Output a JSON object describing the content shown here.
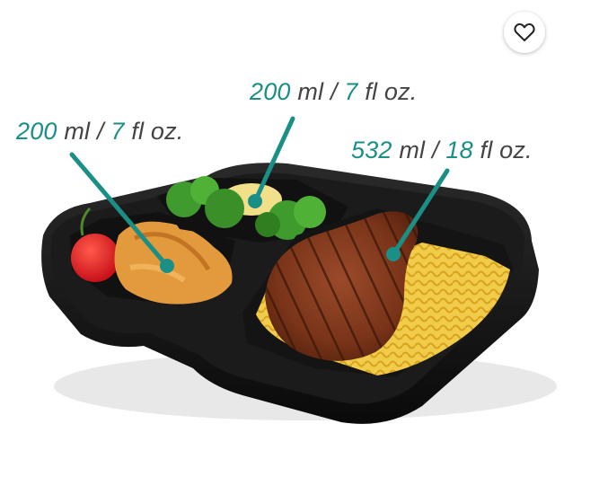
{
  "favorite_button": {
    "icon": "heart-outline-icon",
    "color": "#222222"
  },
  "labels": [
    {
      "vol_num": "200",
      "vol_unit": "ml",
      "sep": "/",
      "oz_num": "7",
      "oz_unit": "fl oz."
    },
    {
      "vol_num": "200",
      "vol_unit": "ml",
      "sep": "/",
      "oz_num": "7",
      "oz_unit": "fl oz."
    },
    {
      "vol_num": "532",
      "vol_unit": "ml",
      "sep": "/",
      "oz_num": "18",
      "oz_unit": "fl oz."
    }
  ],
  "colors": {
    "accent": "#1a8f86",
    "text": "#444444",
    "container": "#151515",
    "background": "#ffffff"
  }
}
